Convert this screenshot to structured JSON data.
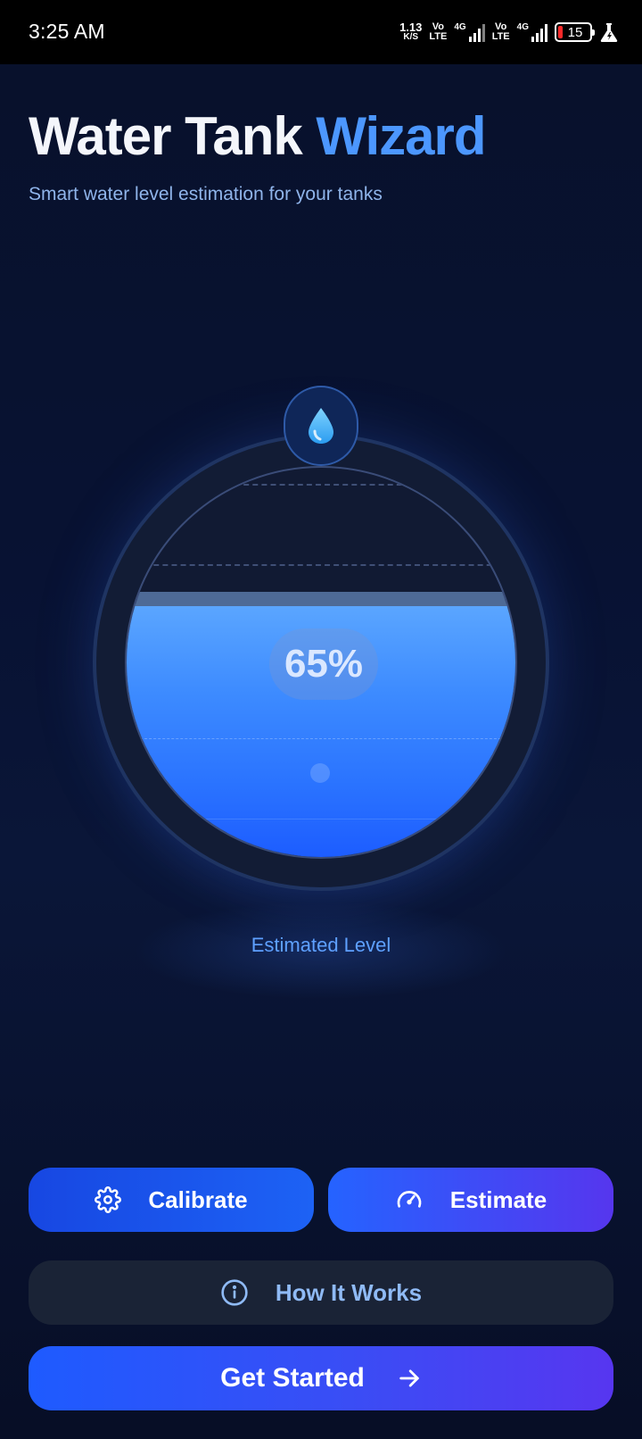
{
  "status_bar": {
    "time": "3:25 AM",
    "net_speed_value": "1.13",
    "net_speed_unit": "K/S",
    "volte_top": "Vo",
    "volte_bottom": "LTE",
    "network_1": "4G",
    "network_2": "4G",
    "battery_level": "15",
    "icons": [
      "volte-icon",
      "signal-icon",
      "signal-icon",
      "battery-icon",
      "flask-icon"
    ]
  },
  "header": {
    "title_main": "Water Tank",
    "title_accent": "Wizard",
    "subtitle": "Smart water level estimation for your tanks"
  },
  "tank": {
    "level_percent": 65,
    "level_text": "65%",
    "label": "Estimated Level",
    "icon": "water-drop-icon"
  },
  "actions": {
    "calibrate_label": "Calibrate",
    "calibrate_icon": "gear-icon",
    "estimate_label": "Estimate",
    "estimate_icon": "speedometer-icon",
    "how_label": "How It Works",
    "how_icon": "info-icon",
    "start_label": "Get Started",
    "start_icon": "arrow-right-icon"
  },
  "colors": {
    "accent": "#4c97ff",
    "water_top": "#5ba6ff",
    "water_bottom": "#1d5dff",
    "button_primary": "#1e5bff",
    "button_secondary": "#5736f0"
  }
}
